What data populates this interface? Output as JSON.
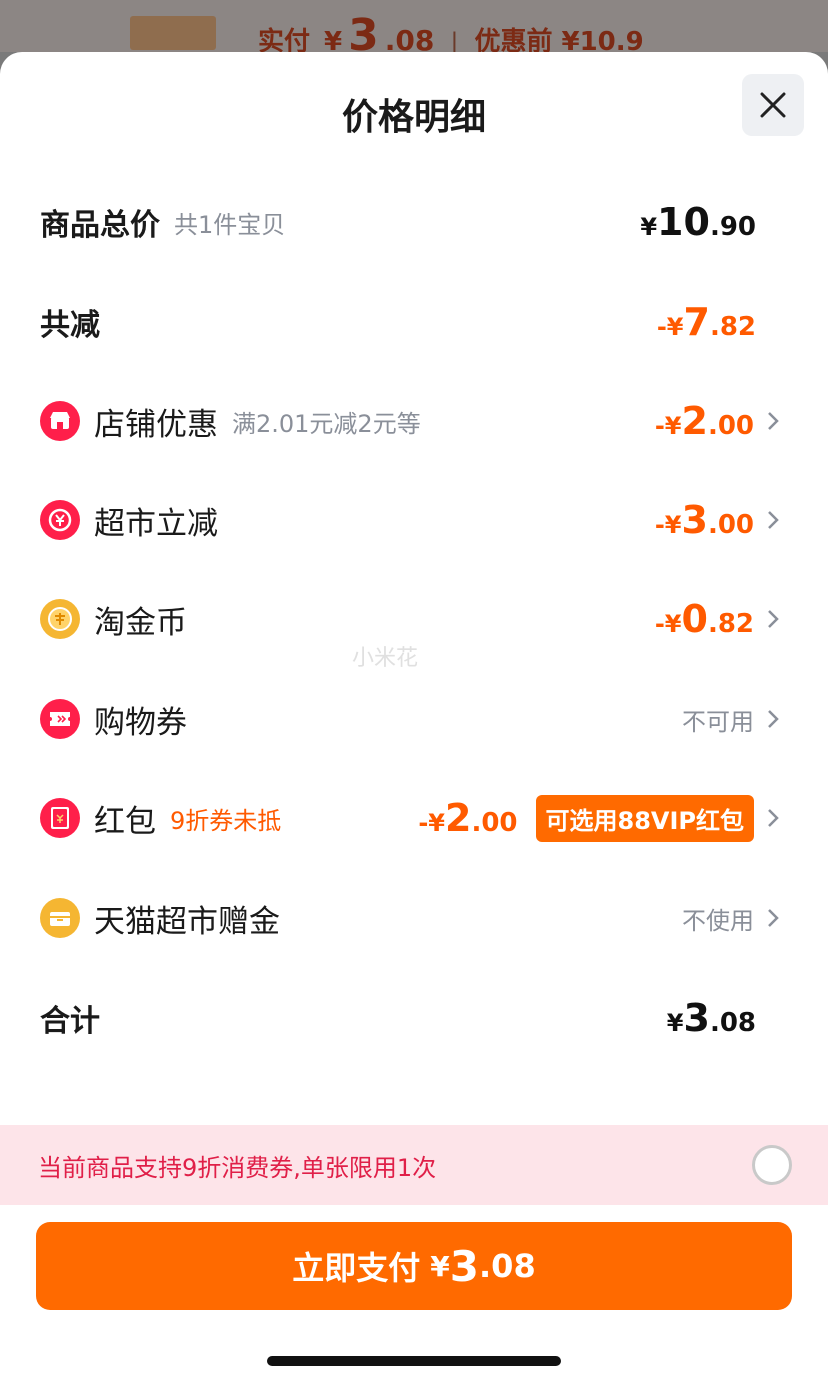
{
  "top": {
    "label": "实付",
    "yen": "¥",
    "big": "3",
    "small": ".08",
    "separator": "|",
    "orig_label": "优惠前 ¥10.9"
  },
  "sheet": {
    "title": "价格明细"
  },
  "rows": {
    "total": {
      "label": "商品总价",
      "sub": "共1件宝贝",
      "yen": "¥",
      "int": "10",
      "dec": ".90"
    },
    "reduce": {
      "label": "共减",
      "yen": "-¥",
      "int": "7",
      "dec": ".82"
    },
    "shop": {
      "label": "店铺优惠",
      "sub": "满2.01元减2元等",
      "yen": "-¥",
      "int": "2",
      "dec": ".00"
    },
    "market": {
      "label": "超市立减",
      "yen": "-¥",
      "int": "3",
      "dec": ".00"
    },
    "coin": {
      "label": "淘金币",
      "yen": "-¥",
      "int": "0",
      "dec": ".82"
    },
    "voucher": {
      "label": "购物券",
      "status": "不可用"
    },
    "redpack": {
      "label": "红包",
      "sub": "9折券未抵",
      "yen": "-¥",
      "int": "2",
      "dec": ".00",
      "badge": "可选用88VIP红包"
    },
    "gift": {
      "label": "天猫超市赠金",
      "status": "不使用"
    },
    "sum": {
      "label": "合计",
      "yen": "¥",
      "int": "3",
      "dec": ".08"
    }
  },
  "watermark": "小米花",
  "notice": {
    "text": "当前商品支持9折消费券,单张限用1次"
  },
  "pay": {
    "label": "立即支付",
    "yen": "¥",
    "int": "3",
    "dec": ".08"
  },
  "colors": {
    "accent": "#ff6a00",
    "price_orange": "#ff5a00",
    "notice_bg": "#fde4e9",
    "notice_text": "#e01f48",
    "icon_red": "#ff1f4a",
    "icon_gold": "#f5b632"
  },
  "icons": {
    "shop": "shop-icon",
    "market": "yen-discount-icon",
    "coin": "coin-icon",
    "voucher": "ticket-icon",
    "redpack": "red-envelope-icon",
    "gift": "gift-card-icon",
    "close": "close-icon",
    "chevron": "chevron-right-icon"
  }
}
